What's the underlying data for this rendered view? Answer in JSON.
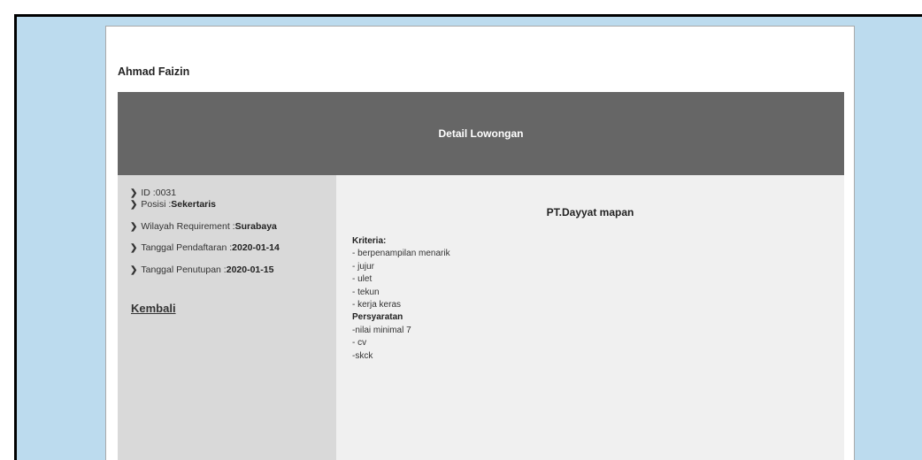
{
  "user": {
    "name": "Ahmad Faizin"
  },
  "header": {
    "title": "Detail Lowongan"
  },
  "sidebar": {
    "id_label": "ID :",
    "id_value": "0031",
    "posisi_label": "Posisi :",
    "posisi_value": "Sekertaris",
    "wilayah_label": "Wilayah Requirement :",
    "wilayah_value": "Surabaya",
    "daftar_label": "Tanggal Pendaftaran :",
    "daftar_value": "2020-01-14",
    "tutup_label": "Tanggal Penutupan :",
    "tutup_value": "2020-01-15",
    "back_label": "Kembali"
  },
  "detail": {
    "company": "PT.Dayyat mapan",
    "kriteria_heading": "Kriteria:",
    "kriteria": [
      "- berpenampilan menarik",
      "- jujur",
      "- ulet",
      "- tekun",
      "- kerja keras"
    ],
    "persyaratan_heading": "Persyaratan",
    "persyaratan": [
      "-nilai minimal 7",
      "- cv",
      "-skck"
    ]
  },
  "icons": {
    "bullet": "chevron-right-icon"
  },
  "colors": {
    "page_bg": "#bcdbee",
    "header_bg": "#666666",
    "sidebar_bg": "#d9d9d9",
    "panel_bg": "#f0f0f0"
  }
}
